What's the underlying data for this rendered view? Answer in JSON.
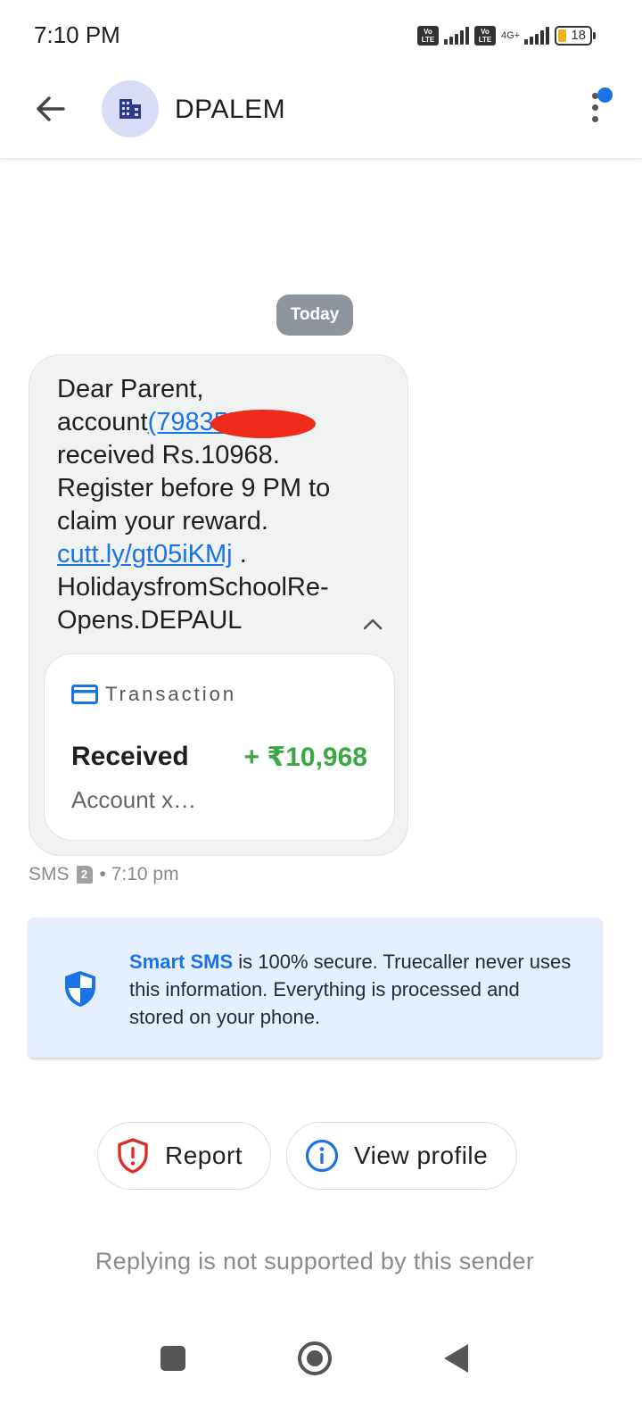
{
  "status_bar": {
    "time": "7:10 PM",
    "volte_label": "Vo LTE",
    "network_label": "4G+",
    "battery_level": "18"
  },
  "app_bar": {
    "title": "DPALEM",
    "icons": {
      "back": "arrow-left-icon",
      "avatar": "building-icon",
      "more": "more-vertical-icon"
    },
    "has_notification": true
  },
  "conversation": {
    "date_chip": "Today",
    "message": {
      "line_greeting": "Dear Parent,",
      "account_prefix": "account",
      "account_link": "(7983",
      "account_link_tail": "5555",
      "account_suffix": ")",
      "line_received": "received Rs.10968.",
      "line_register": "Register before 9 PM to claim your reward.",
      "short_link": "cutt.ly/gt05iKMj",
      "link_suffix": " .",
      "line_footer": "HolidaysfromSchoolRe-Opens.DEPAUL"
    },
    "transaction_card": {
      "header": "Transaction",
      "type": "Received",
      "amount": "+ ₹10,968",
      "account": "Account x…"
    },
    "meta": {
      "channel": "SMS",
      "sim_slot": "2",
      "time": "• 7:10 pm"
    }
  },
  "info_card": {
    "brand": "Smart SMS",
    "text": " is 100% secure. Truecaller never uses this information. Everything is processed and stored on your phone."
  },
  "actions": {
    "report_label": "Report",
    "view_profile_label": "View profile"
  },
  "reply_note": "Replying is not supported by this sender",
  "colors": {
    "accent_blue": "#1a73e8",
    "amount_green": "#3aa845",
    "report_red": "#d93025",
    "avatar_bg": "#d8dcf7",
    "info_bg": "#e6effd",
    "redaction": "#ee2a1a"
  }
}
